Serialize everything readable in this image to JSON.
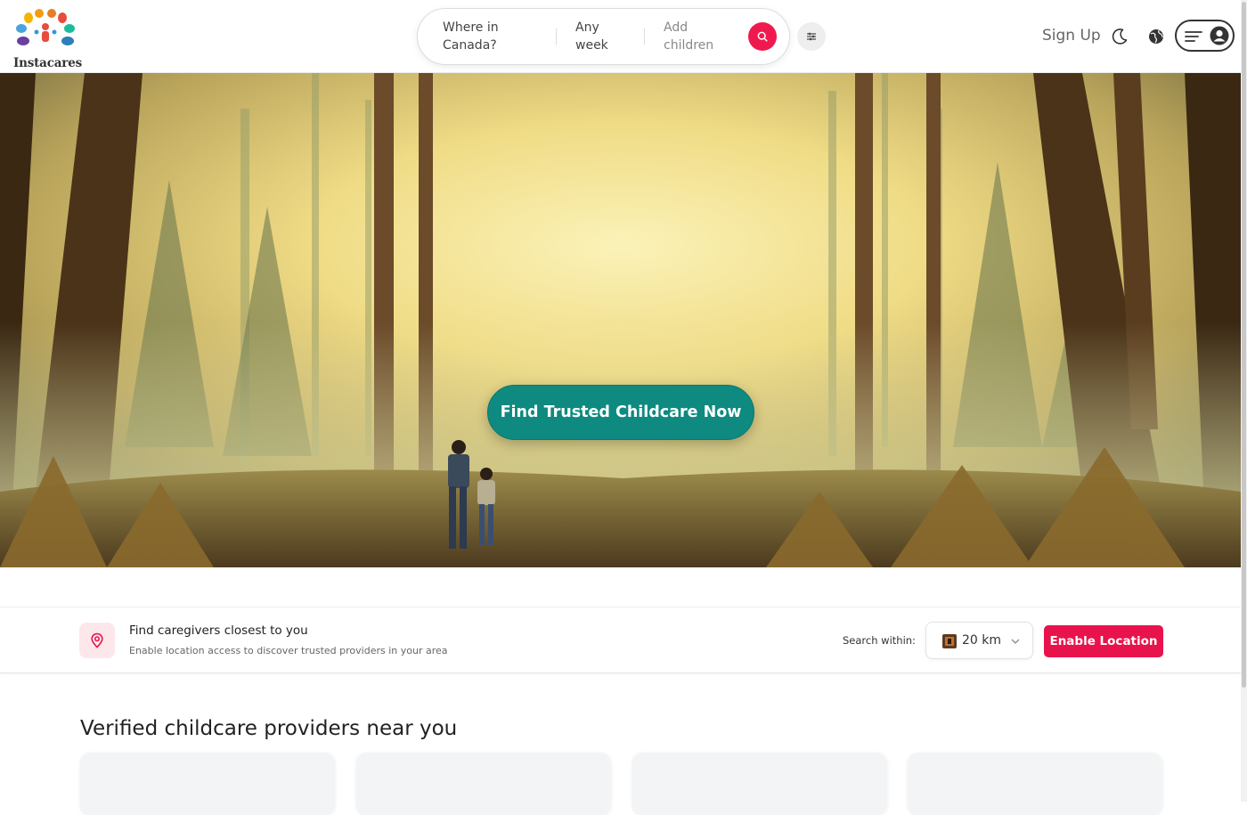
{
  "brand": {
    "name": "Instacares",
    "logo_icon": "peacock-family-logo-icon"
  },
  "search": {
    "location": "Where in Canada?",
    "dates": "Any week",
    "guests": "Add children",
    "search_icon": "search-icon",
    "filter_icon": "sliders-icon"
  },
  "nav": {
    "signup_label": "Sign Up",
    "theme_icon": "moon-icon",
    "language_icon": "globe-icon",
    "menu_icon": "hamburger-icon",
    "account_icon": "user-circle-icon"
  },
  "hero": {
    "cta_label": "Find Trusted Childcare Now",
    "image_description": "forest-with-parent-and-child"
  },
  "location_bar": {
    "title": "Find caregivers closest to you",
    "subtitle": "Enable location access to discover trusted providers in your area",
    "within_label": "Search within:",
    "within_value": "20 km",
    "enable_label": "Enable Location",
    "pin_icon": "location-pin-icon"
  },
  "providers": {
    "title": "Verified childcare providers near you",
    "cards": [
      {},
      {},
      {},
      {}
    ]
  },
  "colors": {
    "accent": "#f0194f",
    "primary_button": "#e8134c",
    "cta": "#0e8a80"
  }
}
